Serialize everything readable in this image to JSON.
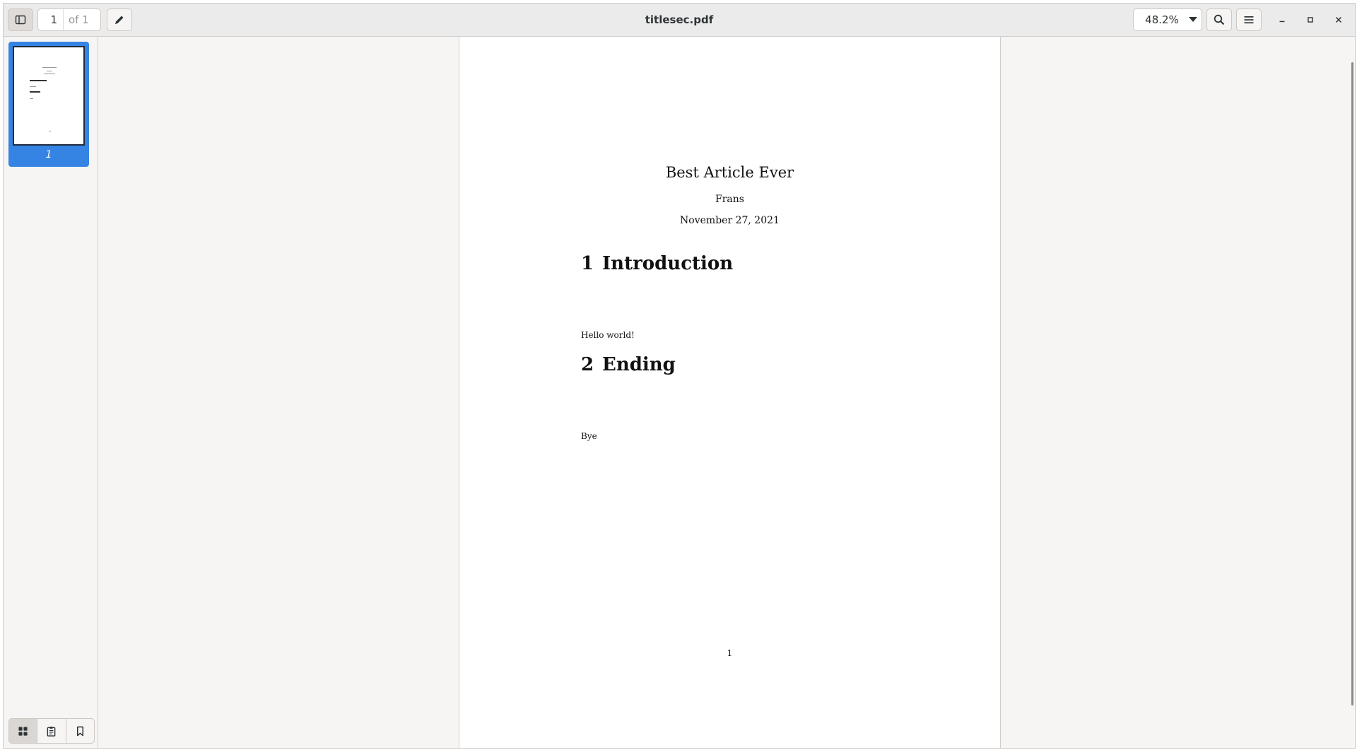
{
  "window": {
    "title": "titlesec.pdf"
  },
  "toolbar": {
    "page_current": "1",
    "page_total_label": "of 1",
    "zoom_value": "48.2%"
  },
  "sidebar": {
    "thumbnail_label": "1",
    "active_tab": "thumbnails"
  },
  "document": {
    "title": "Best Article Ever",
    "author": "Frans",
    "date": "November 27, 2021",
    "sections": [
      {
        "number": "1",
        "heading": "Introduction",
        "body": "Hello world!"
      },
      {
        "number": "2",
        "heading": "Ending",
        "body": "Bye"
      }
    ],
    "page_number": "1"
  },
  "colors": {
    "selection": "#3584e4",
    "headerbar": "#ebebeb",
    "background": "#f6f5f4"
  }
}
